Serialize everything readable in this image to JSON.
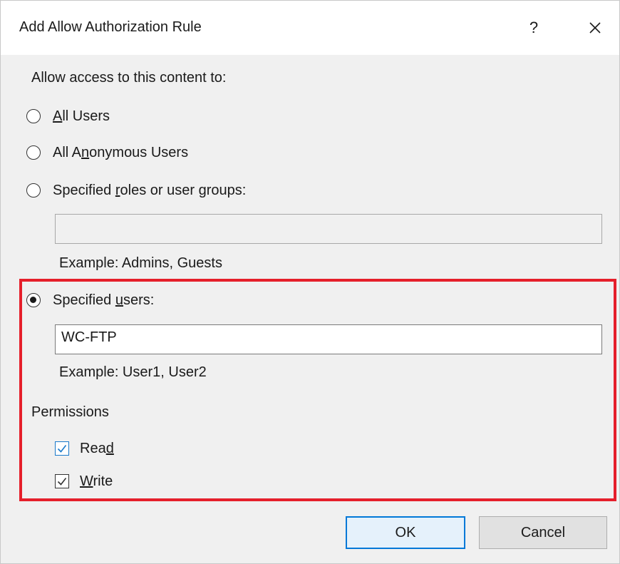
{
  "dialog": {
    "title": "Add Allow Authorization Rule",
    "help_label": "?"
  },
  "access": {
    "heading": "Allow access to this content to:",
    "options": [
      {
        "pre": "",
        "accel": "A",
        "post": "ll Users",
        "selected": false
      },
      {
        "pre": "All A",
        "accel": "n",
        "post": "onymous Users",
        "selected": false
      },
      {
        "pre": "Specified ",
        "accel": "r",
        "post": "oles or user groups:",
        "selected": false
      },
      {
        "pre": "Specified ",
        "accel": "u",
        "post": "sers:",
        "selected": true
      }
    ],
    "roles_value": "",
    "roles_example": "Example: Admins, Guests",
    "users_value": "WC-FTP",
    "users_example": "Example: User1, User2"
  },
  "permissions": {
    "heading": "Permissions",
    "items": [
      {
        "pre": "Rea",
        "accel": "d",
        "post": "",
        "checked": true
      },
      {
        "pre": "",
        "accel": "W",
        "post": "rite",
        "checked": true
      }
    ]
  },
  "buttons": {
    "ok": "OK",
    "cancel": "Cancel"
  },
  "colors": {
    "highlight": "#e51f2b",
    "accent": "#0078d7"
  }
}
